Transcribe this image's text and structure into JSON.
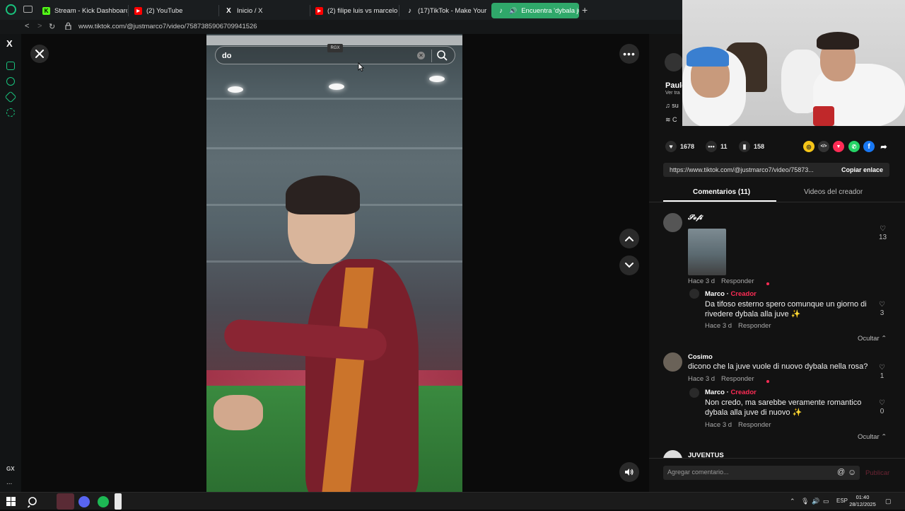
{
  "browser": {
    "tabs": [
      {
        "label": "Stream - Kick Dashboard",
        "favicon_color": "#53fc18",
        "favicon_glyph": "K"
      },
      {
        "label": "(2) YouTube",
        "favicon_color": "#ff0000",
        "favicon_glyph": "▶"
      },
      {
        "label": "Inicio / X",
        "favicon_color": "#000000",
        "favicon_glyph": "X"
      },
      {
        "label": "(2) filipe luis vs marcelo -",
        "favicon_color": "#ff0000",
        "favicon_glyph": "▶"
      },
      {
        "label": "(17)TikTok - Make Your D",
        "favicon_color": "#111111",
        "favicon_glyph": "♪"
      },
      {
        "label": "Encuentra 'dybala juve",
        "favicon_color": "#111111",
        "favicon_glyph": "♪"
      }
    ],
    "url": "www.tiktok.com/@justmarco7/video/7587385906709941526",
    "accent_color": "#2fa86a"
  },
  "sidebar": {
    "x_label": "X",
    "gx_label": "GX",
    "more_label": "..."
  },
  "video_search": {
    "value": "do",
    "badge": "RGX"
  },
  "author": {
    "name": "Paulo",
    "sub": "Ver tra",
    "music": "su",
    "caption": "C"
  },
  "stats": {
    "likes": "1678",
    "comments": "11",
    "saves": "158"
  },
  "share_icons": [
    {
      "name": "coin-share-icon",
      "color": "#f5c518",
      "glyph": "◎"
    },
    {
      "name": "embed-icon",
      "color": "#333333",
      "glyph": "</>"
    },
    {
      "name": "send-friends-icon",
      "color": "#fe2c55",
      "glyph": "▼"
    },
    {
      "name": "whatsapp-icon",
      "color": "#25d366",
      "glyph": "✆"
    },
    {
      "name": "facebook-icon",
      "color": "#1877f2",
      "glyph": "f"
    },
    {
      "name": "share-arrow-icon",
      "color": "#121212",
      "glyph": "➦"
    }
  ],
  "link": {
    "text": "https://www.tiktok.com/@justmarco7/video/75873...",
    "copy_label": "Copiar enlace"
  },
  "panel_tabs": {
    "comments": "Comentarios (11)",
    "creator_videos": "Videos del creador"
  },
  "comments": [
    {
      "user": "𝓢𝓸𝓯𝓲",
      "time": "Hace 3 d",
      "reply": "Responder",
      "likes": "13",
      "replies": [
        {
          "user": "Marco",
          "badge": "Creador",
          "text": "Da tifoso esterno spero comunque un giorno di rivedere dybala alla juve ✨",
          "time": "Hace 3 d",
          "reply": "Responder",
          "likes": "3"
        }
      ],
      "hide_label": "Ocultar"
    },
    {
      "user": "Cosimo",
      "text": "dicono che la juve vuole di nuovo dybala nella rosa?",
      "time": "Hace 3 d",
      "reply": "Responder",
      "likes": "1",
      "replies": [
        {
          "user": "Marco",
          "badge": "Creador",
          "text": "Non credo, ma sarebbe veramente romantico dybala alla juve di nuovo ✨",
          "time": "Hace 3 d",
          "reply": "Responder",
          "likes": "0"
        }
      ],
      "hide_label": "Ocultar"
    },
    {
      "user": "JUVENTUS"
    }
  ],
  "comment_box": {
    "placeholder": "Agregar comentario...",
    "post_label": "Publicar"
  },
  "taskbar": {
    "lang": "ESP",
    "time": "01:40",
    "date": "28/12/2025"
  }
}
